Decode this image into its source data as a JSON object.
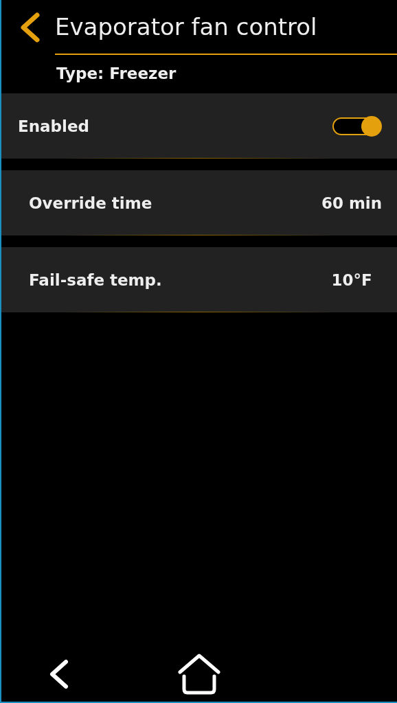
{
  "header": {
    "title": "Evaporator fan control",
    "subtitle": "Type: Freezer"
  },
  "settings": [
    {
      "kind": "toggle",
      "label": "Enabled",
      "on": true
    },
    {
      "kind": "value",
      "label": "Override time",
      "value": "60 min"
    },
    {
      "kind": "value",
      "label": "Fail-safe temp.",
      "value": "10°F"
    }
  ]
}
